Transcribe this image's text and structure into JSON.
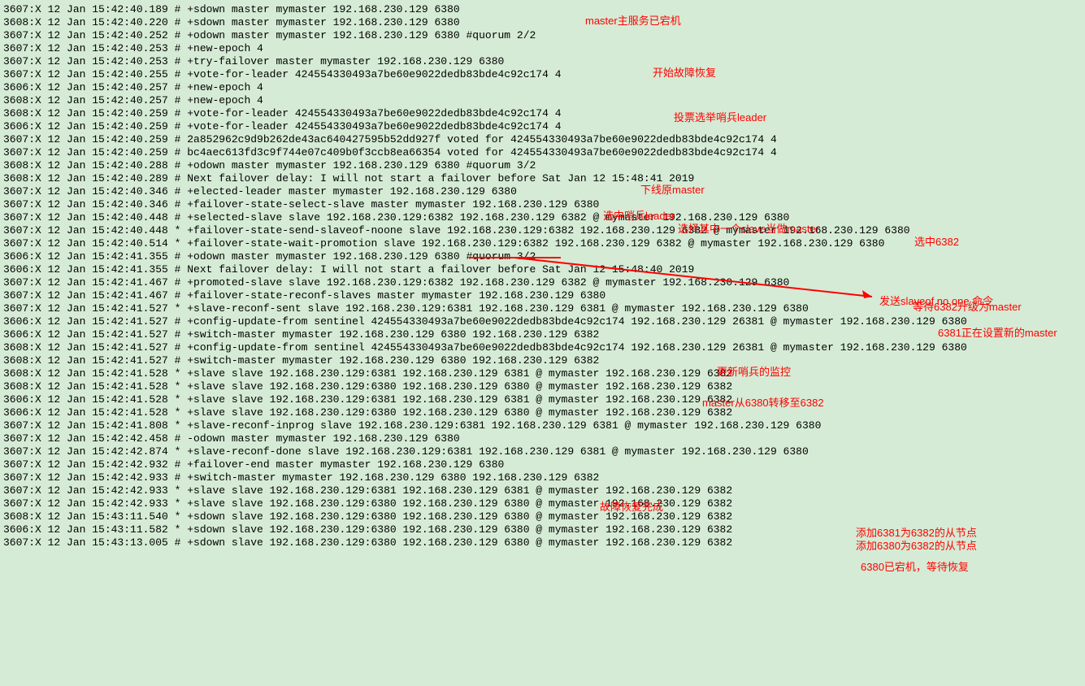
{
  "log_lines": [
    "3607:X 12 Jan 15:42:40.189 # +sdown master mymaster 192.168.230.129 6380",
    "3608:X 12 Jan 15:42:40.220 # +sdown master mymaster 192.168.230.129 6380",
    "3607:X 12 Jan 15:42:40.252 # +odown master mymaster 192.168.230.129 6380 #quorum 2/2",
    "3607:X 12 Jan 15:42:40.253 # +new-epoch 4",
    "3607:X 12 Jan 15:42:40.253 # +try-failover master mymaster 192.168.230.129 6380",
    "3607:X 12 Jan 15:42:40.255 # +vote-for-leader 424554330493a7be60e9022dedb83bde4c92c174 4",
    "3606:X 12 Jan 15:42:40.257 # +new-epoch 4",
    "3608:X 12 Jan 15:42:40.257 # +new-epoch 4",
    "3608:X 12 Jan 15:42:40.259 # +vote-for-leader 424554330493a7be60e9022dedb83bde4c92c174 4",
    "3606:X 12 Jan 15:42:40.259 # +vote-for-leader 424554330493a7be60e9022dedb83bde4c92c174 4",
    "3607:X 12 Jan 15:42:40.259 # 2a852962c9d9b262de43ac640427595b52dd927f voted for 424554330493a7be60e9022dedb83bde4c92c174 4",
    "3607:X 12 Jan 15:42:40.259 # bc4aec613fd3c9f744e07c409b0f3ccb8ea66354 voted for 424554330493a7be60e9022dedb83bde4c92c174 4",
    "3608:X 12 Jan 15:42:40.288 # +odown master mymaster 192.168.230.129 6380 #quorum 3/2",
    "3608:X 12 Jan 15:42:40.289 # Next failover delay: I will not start a failover before Sat Jan 12 15:48:41 2019",
    "3607:X 12 Jan 15:42:40.346 # +elected-leader master mymaster 192.168.230.129 6380",
    "3607:X 12 Jan 15:42:40.346 # +failover-state-select-slave master mymaster 192.168.230.129 6380",
    "3607:X 12 Jan 15:42:40.448 # +selected-slave slave 192.168.230.129:6382 192.168.230.129 6382 @ mymaster 192.168.230.129 6380",
    "3607:X 12 Jan 15:42:40.448 * +failover-state-send-slaveof-noone slave 192.168.230.129:6382 192.168.230.129 6382 @ mymaster 192.168.230.129 6380",
    "3607:X 12 Jan 15:42:40.514 * +failover-state-wait-promotion slave 192.168.230.129:6382 192.168.230.129 6382 @ mymaster 192.168.230.129 6380",
    "3606:X 12 Jan 15:42:41.355 # +odown master mymaster 192.168.230.129 6380 #quorum 3/2",
    "3606:X 12 Jan 15:42:41.355 # Next failover delay: I will not start a failover before Sat Jan 12 15:48:40 2019",
    "3607:X 12 Jan 15:42:41.467 # +promoted-slave slave 192.168.230.129:6382 192.168.230.129 6382 @ mymaster 192.168.230.129 6380",
    "3607:X 12 Jan 15:42:41.467 # +failover-state-reconf-slaves master mymaster 192.168.230.129 6380",
    "3607:X 12 Jan 15:42:41.527 * +slave-reconf-sent slave 192.168.230.129:6381 192.168.230.129 6381 @ mymaster 192.168.230.129 6380",
    "3606:X 12 Jan 15:42:41.527 # +config-update-from sentinel 424554330493a7be60e9022dedb83bde4c92c174 192.168.230.129 26381 @ mymaster 192.168.230.129 6380",
    "3606:X 12 Jan 15:42:41.527 # +switch-master mymaster 192.168.230.129 6380 192.168.230.129 6382",
    "3608:X 12 Jan 15:42:41.527 # +config-update-from sentinel 424554330493a7be60e9022dedb83bde4c92c174 192.168.230.129 26381 @ mymaster 192.168.230.129 6380",
    "3608:X 12 Jan 15:42:41.527 # +switch-master mymaster 192.168.230.129 6380 192.168.230.129 6382",
    "3608:X 12 Jan 15:42:41.528 * +slave slave 192.168.230.129:6381 192.168.230.129 6381 @ mymaster 192.168.230.129 6382",
    "3608:X 12 Jan 15:42:41.528 * +slave slave 192.168.230.129:6380 192.168.230.129 6380 @ mymaster 192.168.230.129 6382",
    "3606:X 12 Jan 15:42:41.528 * +slave slave 192.168.230.129:6381 192.168.230.129 6381 @ mymaster 192.168.230.129 6382",
    "3606:X 12 Jan 15:42:41.528 * +slave slave 192.168.230.129:6380 192.168.230.129 6380 @ mymaster 192.168.230.129 6382",
    "3607:X 12 Jan 15:42:41.808 * +slave-reconf-inprog slave 192.168.230.129:6381 192.168.230.129 6381 @ mymaster 192.168.230.129 6380",
    "3607:X 12 Jan 15:42:42.458 # -odown master mymaster 192.168.230.129 6380",
    "3607:X 12 Jan 15:42:42.874 * +slave-reconf-done slave 192.168.230.129:6381 192.168.230.129 6381 @ mymaster 192.168.230.129 6380",
    "3607:X 12 Jan 15:42:42.932 # +failover-end master mymaster 192.168.230.129 6380",
    "3607:X 12 Jan 15:42:42.933 # +switch-master mymaster 192.168.230.129 6380 192.168.230.129 6382",
    "3607:X 12 Jan 15:42:42.933 * +slave slave 192.168.230.129:6381 192.168.230.129 6381 @ mymaster 192.168.230.129 6382",
    "3607:X 12 Jan 15:42:42.933 * +slave slave 192.168.230.129:6380 192.168.230.129 6380 @ mymaster 192.168.230.129 6382",
    "3608:X 12 Jan 15:43:11.540 * +sdown slave 192.168.230.129:6380 192.168.230.129 6380 @ mymaster 192.168.230.129 6382",
    "3606:X 12 Jan 15:43:11.582 * +sdown slave 192.168.230.129:6380 192.168.230.129 6380 @ mymaster 192.168.230.129 6382",
    "3607:X 12 Jan 15:43:13.005 # +sdown slave 192.168.230.129:6380 192.168.230.129 6380 @ mymaster 192.168.230.129 6382"
  ],
  "annotations": {
    "a1": "master主服务已宕机",
    "a2": "开始故障恢复",
    "a3": "投票选举哨兵leader",
    "a4": "下线原master",
    "a5": "选中哨兵leader",
    "a6": "选择其中一个slave当做master",
    "a7": "选中6382",
    "a8": "发送slaveof no one 命令",
    "a9": "等待6382升级为master",
    "a10": "6381正在设置新的master",
    "a11": "更新哨兵的监控",
    "a12": "master从6380转移至6382",
    "a13": "故障恢复完成",
    "a14": "添加6381为6382的从节点",
    "a15": "添加6380为6382的从节点",
    "a16": "6380已宕机，等待恢复"
  }
}
